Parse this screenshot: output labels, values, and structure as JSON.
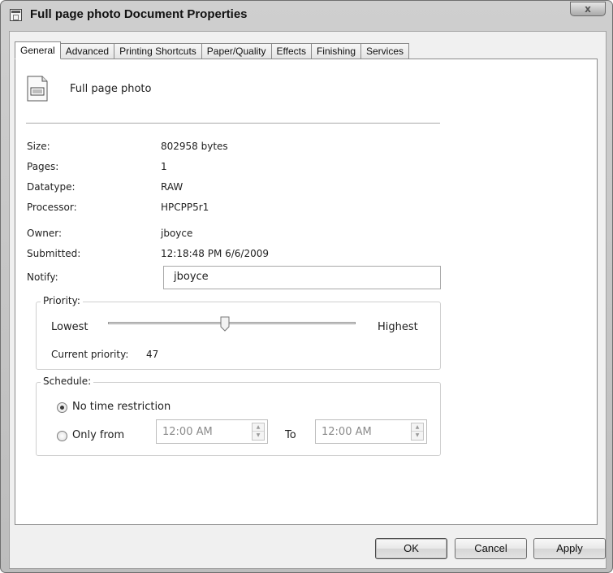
{
  "window": {
    "title": "Full page photo Document Properties",
    "close_glyph": "x"
  },
  "tabs": [
    {
      "label": "General",
      "active": true
    },
    {
      "label": "Advanced"
    },
    {
      "label": "Printing Shortcuts"
    },
    {
      "label": "Paper/Quality"
    },
    {
      "label": "Effects"
    },
    {
      "label": "Finishing"
    },
    {
      "label": "Services"
    }
  ],
  "general": {
    "document_name": "Full page photo",
    "fields": {
      "size": {
        "label": "Size:",
        "value": "802958 bytes"
      },
      "pages": {
        "label": "Pages:",
        "value": "1"
      },
      "datatype": {
        "label": "Datatype:",
        "value": "RAW"
      },
      "processor": {
        "label": "Processor:",
        "value": "HPCPP5r1"
      },
      "owner": {
        "label": "Owner:",
        "value": "jboyce"
      },
      "submitted": {
        "label": "Submitted:",
        "value": "12:18:48 PM  6/6/2009"
      }
    },
    "notify": {
      "label": "Notify:",
      "value": "jboyce"
    },
    "priority": {
      "group_label": "Priority:",
      "lowest": "Lowest",
      "highest": "Highest",
      "current_label": "Current priority:",
      "current_value": "47"
    },
    "schedule": {
      "group_label": "Schedule:",
      "no_restriction": "No time restriction",
      "only_from": "Only from",
      "from_time": "12:00 AM",
      "to_label": "To",
      "to_time": "12:00 AM",
      "selected": "no_restriction"
    }
  },
  "buttons": {
    "ok": "OK",
    "cancel": "Cancel",
    "apply": "Apply"
  }
}
